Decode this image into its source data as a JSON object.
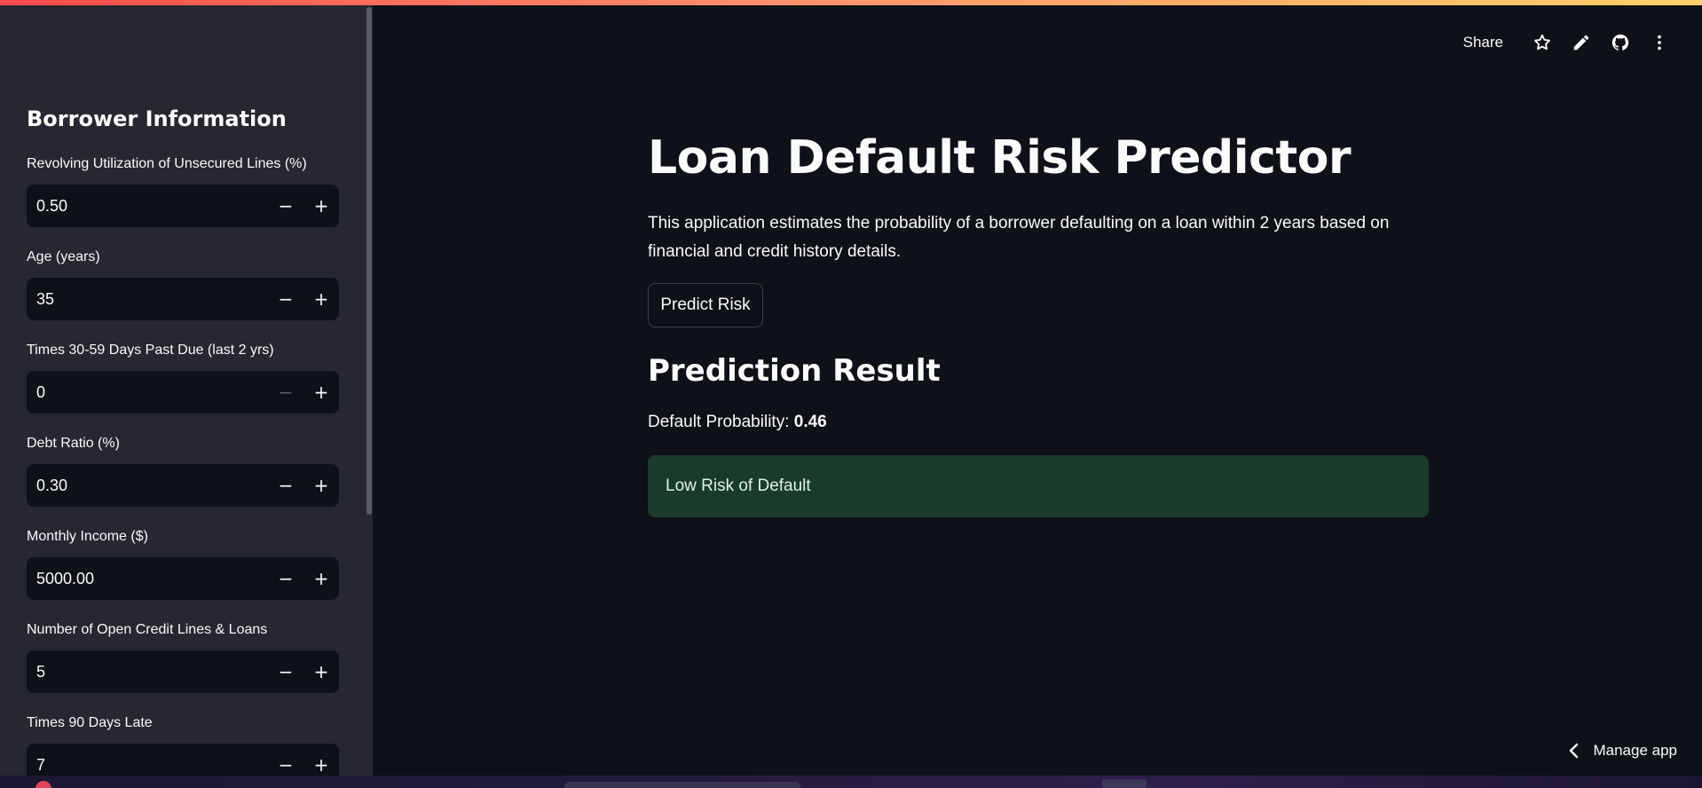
{
  "sidebar": {
    "heading": "Borrower Information",
    "fields": [
      {
        "label": "Revolving Utilization of Unsecured Lines (%)",
        "value": "0.50",
        "minus_enabled": true
      },
      {
        "label": "Age (years)",
        "value": "35",
        "minus_enabled": true
      },
      {
        "label": "Times 30-59 Days Past Due (last 2 yrs)",
        "value": "0",
        "minus_enabled": false
      },
      {
        "label": "Debt Ratio (%)",
        "value": "0.30",
        "minus_enabled": true
      },
      {
        "label": "Monthly Income ($)",
        "value": "5000.00",
        "minus_enabled": true
      },
      {
        "label": "Number of Open Credit Lines & Loans",
        "value": "5",
        "minus_enabled": true
      },
      {
        "label": "Times 90 Days Late",
        "value": "7",
        "minus_enabled": true
      }
    ],
    "minus_symbol": "−",
    "plus_symbol": "+"
  },
  "toolbar": {
    "share_label": "Share",
    "icons": [
      "star-icon",
      "pencil-icon",
      "github-icon",
      "more-vertical-icon"
    ]
  },
  "main": {
    "title": "Loan Default Risk Predictor",
    "description": "This application estimates the probability of a borrower defaulting on a loan within 2 years based on financial and credit history details.",
    "predict_button": "Predict Risk",
    "result_heading": "Prediction Result",
    "probability_label": "Default Probability: ",
    "probability_value": "0.46",
    "alert_text": "Low Risk of Default"
  },
  "footer": {
    "manage_app_label": "Manage app"
  },
  "colors": {
    "background": "#0e1117",
    "sidebar": "#262730",
    "success_bg": "#1c3a2a",
    "accent_gradient_start": "#ff4b4b",
    "accent_gradient_end": "#ffd16a"
  }
}
